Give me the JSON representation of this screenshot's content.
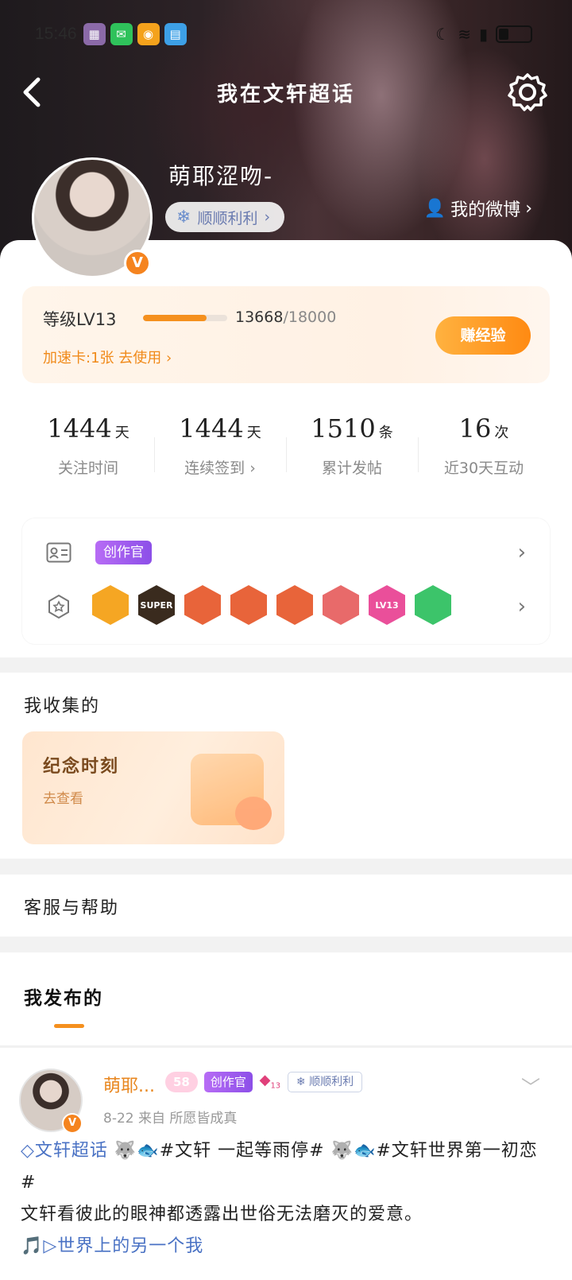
{
  "status_bar": {
    "time": "15:46",
    "apps": [
      "photo-app",
      "wechat",
      "weibo",
      "book"
    ]
  },
  "header": {
    "title": "我在文轩超话"
  },
  "profile": {
    "username": "萌耶涩吻-",
    "tag_label": "顺顺利利",
    "my_weibo": "我的微博"
  },
  "level": {
    "label": "等级LV13",
    "exp_current": "13668",
    "exp_max": "/18000",
    "progress": 0.759,
    "speed_card": "加速卡:1张 去使用",
    "earn_label": "赚经验"
  },
  "stats": [
    {
      "value": "1444",
      "unit": "天",
      "label": "关注时间"
    },
    {
      "value": "1444",
      "unit": "天",
      "label": "连续签到"
    },
    {
      "value": "1510",
      "unit": "条",
      "label": "累计发帖"
    },
    {
      "value": "16",
      "unit": "次",
      "label": "近30天互动"
    }
  ],
  "badges_row": {
    "creator_label": "创作官",
    "badges": [
      {
        "icon": "crown-gold-badge",
        "color": "#f5a623",
        "text": ""
      },
      {
        "icon": "super-crown-badge",
        "color": "#3a2b1e",
        "text": "SUPER"
      },
      {
        "icon": "rabbit-badge-1",
        "color": "#e8643a",
        "text": ""
      },
      {
        "icon": "rabbit-badge-2",
        "color": "#e8643a",
        "text": ""
      },
      {
        "icon": "rabbit-badge-3",
        "color": "#e8643a",
        "text": ""
      },
      {
        "icon": "rabbit-badge-4",
        "color": "#e86a6a",
        "text": ""
      },
      {
        "icon": "lv-badge",
        "color": "#ea4f9a",
        "text": "LV13"
      },
      {
        "icon": "hand-badge",
        "color": "#3cc46a",
        "text": ""
      }
    ]
  },
  "collection": {
    "title": "我收集的",
    "memory_title": "纪念时刻",
    "memory_sub": "去查看"
  },
  "help": {
    "title": "客服与帮助"
  },
  "published": {
    "tab": "我发布的"
  },
  "post": {
    "name": "萌耶...",
    "lv_tag": "58",
    "creator_tag": "创作官",
    "gem_tag": "13",
    "smooth_tag": "顺顺利利",
    "meta": "8-22  来自 所愿皆成真",
    "line1_topic": "文轩超话",
    "line1_rest": " 🐺🐟#文轩 一起等雨停# 🐺🐟#文轩世界第一初恋#",
    "line2": "文轩看彼此的眼神都透露出世俗无法磨灭的爱意。",
    "line3": "🎵▷世界上的另一个我"
  },
  "colors": {
    "accent": "#f5901e",
    "creator_purple": "#9b59f0",
    "topic_blue": "#4a72c4"
  }
}
